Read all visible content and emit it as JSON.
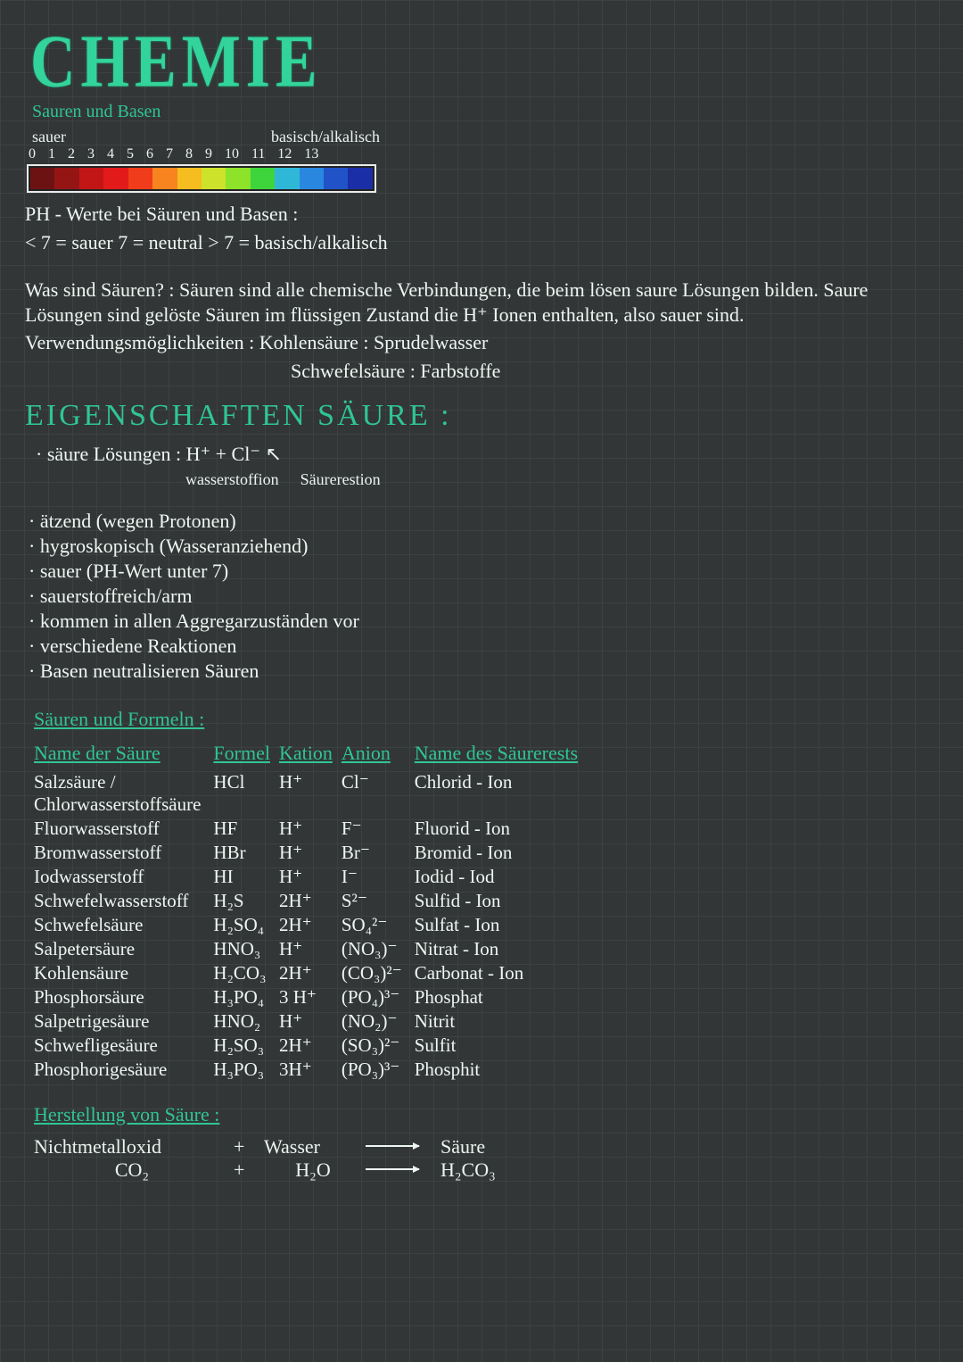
{
  "title": "CHEMIE",
  "subtitle": "Sauren und Basen",
  "ph_scale": {
    "label_left": "sauer",
    "label_right": "basisch/alkalisch",
    "ticks": [
      "0",
      "1",
      "2",
      "3",
      "4",
      "5",
      "6",
      "7",
      "8",
      "9",
      "10",
      "11",
      "12",
      "13"
    ],
    "colors": [
      "#6d1212",
      "#951515",
      "#c21616",
      "#e31a1a",
      "#f03c1a",
      "#f7841e",
      "#f5bd1f",
      "#cde22a",
      "#8de22a",
      "#3ed43c",
      "#2fb7d8",
      "#2a87e0",
      "#2152c8",
      "#1a2fa7"
    ]
  },
  "ph_text1": "PH - Werte bei Säuren und Basen :",
  "ph_text2": "< 7 = sauer   7 = neutral   > 7 = basisch/alkalisch",
  "what_title": "Was sind Säuren? :",
  "what_body": "Säuren sind alle chemische Verbindungen, die beim lösen saure Lösungen bilden. Saure Lösungen sind gelöste Säuren im flüssigen Zustand die H⁺ Ionen enthalten, also sauer sind.",
  "usage_label": "Verwendungsmöglichkeiten :",
  "usage1": "Kohlensäure : Sprudelwasser",
  "usage2": "Schwefelsäure : Farbstoffe",
  "props_heading": "EIGENSCHAFTEN SÄURE :",
  "ion_line": "säure Lösungen  :  H⁺  +  Cl⁻",
  "ion_annot1": "wasserstoffion",
  "ion_annot2": "Säurerestion",
  "bullets": [
    "ätzend (wegen Protonen)",
    "hygroskopisch (Wasseranziehend)",
    "sauer (PH-Wert unter 7)",
    "sauerstoffreich/arm",
    "kommen in allen Aggregarzuständen vor",
    "verschiedene Reaktionen",
    "Basen neutralisieren Säuren"
  ],
  "table_heading": "Säuren und Formeln :",
  "table": {
    "headers": [
      "Name der Säure",
      "Formel",
      "Kation",
      "Anion",
      "Name des Säurerests"
    ],
    "rows": [
      {
        "name": "Salzsäure /\nChlorwasserstoffsäure",
        "formel": "HCl",
        "kation": "H⁺",
        "anion": "Cl⁻",
        "rest": "Chlorid - Ion"
      },
      {
        "name": "Fluorwasserstoff",
        "formel": "HF",
        "kation": "H⁺",
        "anion": "F⁻",
        "rest": "Fluorid - Ion"
      },
      {
        "name": "Bromwasserstoff",
        "formel": "HBr",
        "kation": "H⁺",
        "anion": "Br⁻",
        "rest": "Bromid - Ion"
      },
      {
        "name": "Iodwasserstoff",
        "formel": "HI",
        "kation": "H⁺",
        "anion": "I⁻",
        "rest": "Iodid - Iod"
      },
      {
        "name": "Schwefelwasserstoff",
        "formel": "H₂S",
        "kation": "2H⁺",
        "anion": "S²⁻",
        "rest": "Sulfid - Ion"
      },
      {
        "name": "Schwefelsäure",
        "formel": "H₂SO₄",
        "kation": "2H⁺",
        "anion": "SO₄²⁻",
        "rest": "Sulfat - Ion"
      },
      {
        "name": "Salpetersäure",
        "formel": "HNO₃",
        "kation": "H⁺",
        "anion": "(NO₃)⁻",
        "rest": "Nitrat - Ion"
      },
      {
        "name": "Kohlensäure",
        "formel": "H₂CO₃",
        "kation": "2H⁺",
        "anion": "(CO₃)²⁻",
        "rest": "Carbonat - Ion"
      },
      {
        "name": "Phosphorsäure",
        "formel": "H₃PO₄",
        "kation": "3 H⁺",
        "anion": "(PO₄)³⁻",
        "rest": "Phosphat"
      },
      {
        "name": "Salpetrigesäure",
        "formel": "HNO₂",
        "kation": "H⁺",
        "anion": "(NO₂)⁻",
        "rest": "Nitrit"
      },
      {
        "name": "Schwefligesäure",
        "formel": "H₂SO₃",
        "kation": "2H⁺",
        "anion": "(SO₃)²⁻",
        "rest": "Sulfit"
      },
      {
        "name": "Phosphorigesäure",
        "formel": "H₃PO₃",
        "kation": "3H⁺",
        "anion": "(PO₃)³⁻",
        "rest": "Phosphit"
      }
    ]
  },
  "make_heading": "Herstellung von Säure :",
  "eq1": {
    "a": "Nichtmetalloxid",
    "p": "+",
    "b": "Wasser",
    "c": "Säure"
  },
  "eq2": {
    "a": "CO₂",
    "p": "+",
    "b": "H₂O",
    "c": "H₂CO₃"
  }
}
